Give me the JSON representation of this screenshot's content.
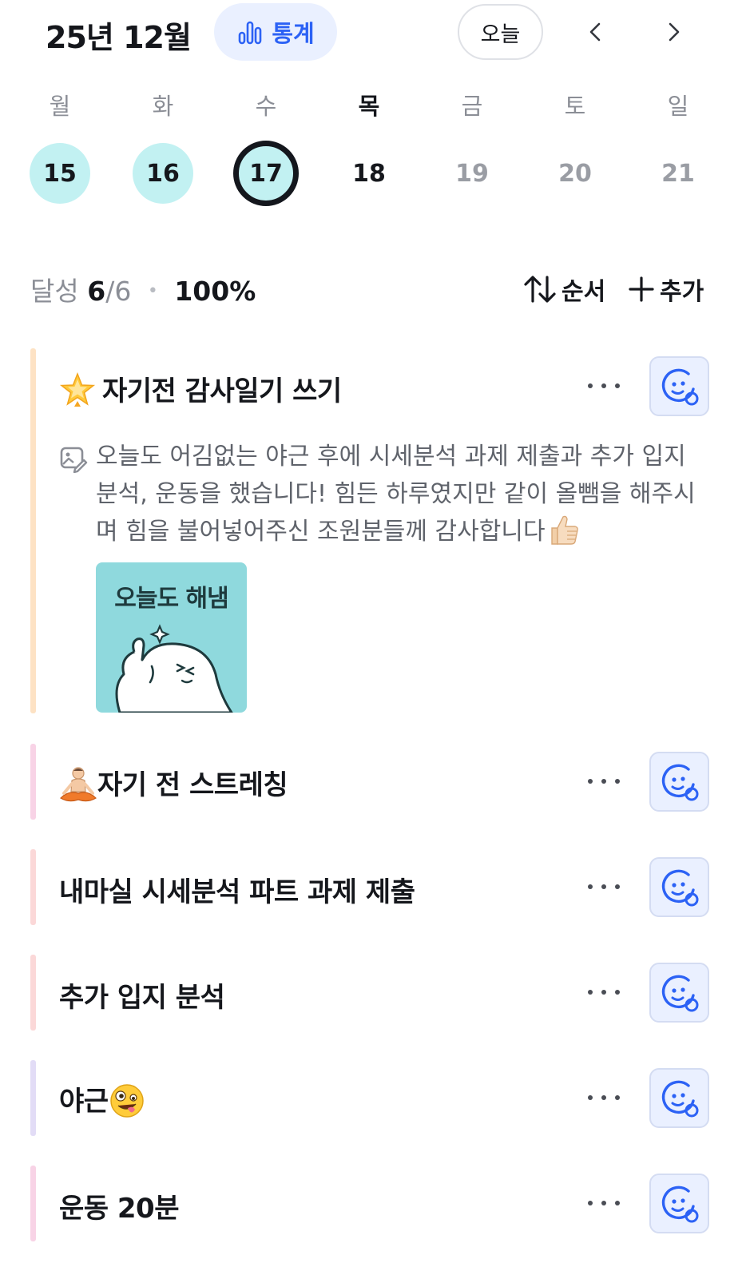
{
  "header": {
    "month_title": "25년 12월",
    "stats_label": "통계",
    "today_label": "오늘"
  },
  "week": {
    "weekdays": [
      "월",
      "화",
      "수",
      "목",
      "금",
      "토",
      "일"
    ],
    "days": [
      "15",
      "16",
      "17",
      "18",
      "19",
      "20",
      "21"
    ],
    "current_weekday_index": 3,
    "selected_day": "17"
  },
  "summary": {
    "label": "달성",
    "done": "6",
    "slash": "/",
    "total": "6",
    "percent": "100%",
    "sort_label": "순서",
    "add_label": "추가"
  },
  "habits": [
    {
      "title": "자기전 감사일기 쓰기",
      "emoji_icon": "glowing-star",
      "bar_color": "#fde2c4",
      "memo": "오늘도 어김없는 야근 후에 시세분석 과제 제출과 추가 입지 분석, 운동을 했습니다! 힘든 하루였지만 같이 올뺌을 해주시며 힘을 불어넣어주신 조원분들께 감사합니다",
      "memo_emoji_icon": "thumbs-up",
      "sticker_text": "오늘도 해냄"
    },
    {
      "title": "자기 전 스트레칭",
      "emoji_icon": "lotus-position-person",
      "bar_color": "#f8d3e6"
    },
    {
      "title": "내마실 시세분석 파트 과제 제출",
      "bar_color": "#fbd8d8"
    },
    {
      "title": "추가 입지 분석",
      "bar_color": "#fbd8d8"
    },
    {
      "title": "야근",
      "emoji_icon": "zany-face",
      "bar_color": "#e2dcf6"
    },
    {
      "title": "운동 20분",
      "bar_color": "#f8d3e6"
    }
  ],
  "colors": {
    "accent_blue": "#2c62f5",
    "done_day": "#c2f1f2",
    "mood_bg": "#eaf0ff"
  }
}
